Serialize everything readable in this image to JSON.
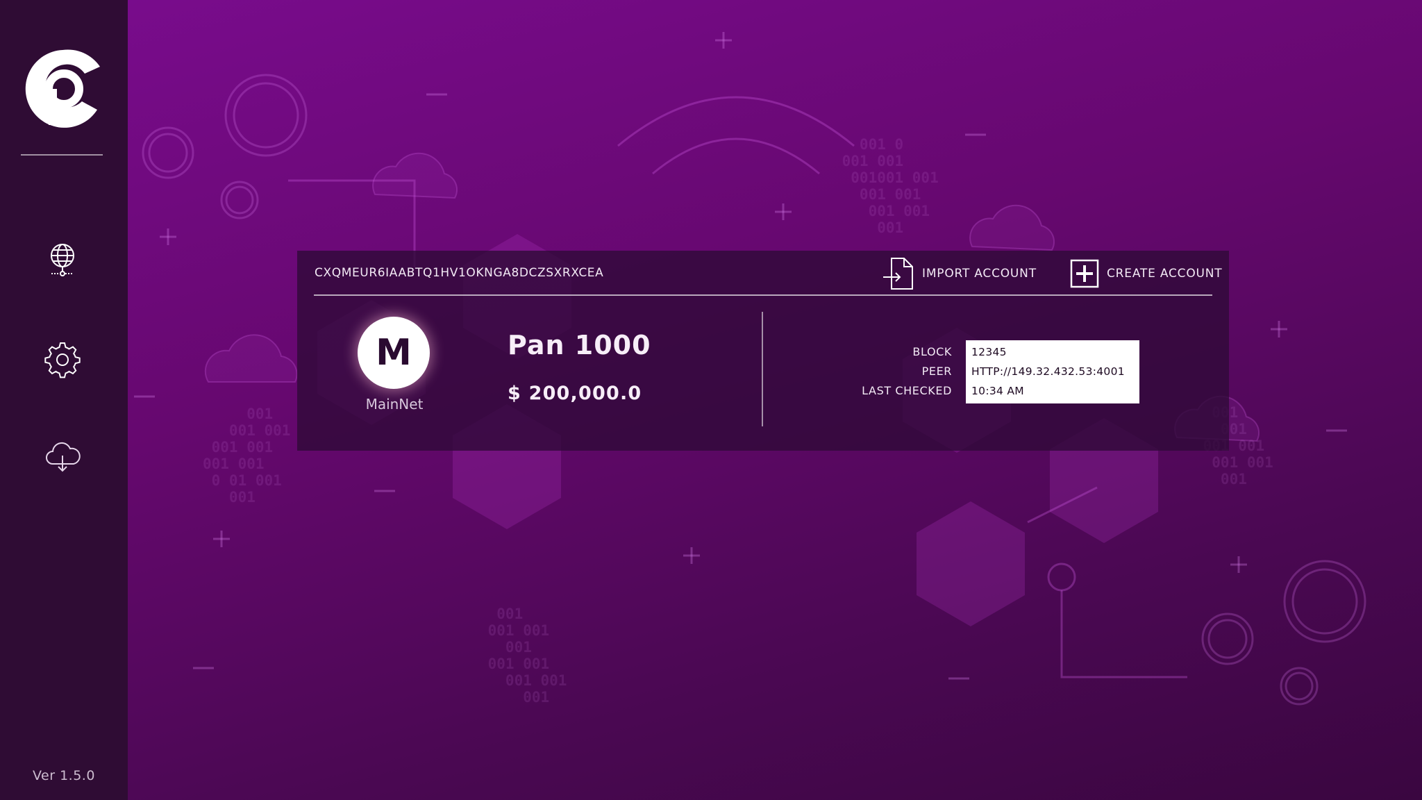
{
  "app": {
    "version": "Ver 1.5.0",
    "logo_icon": "p-logo-icon"
  },
  "sidebar": {
    "items": [
      {
        "name": "network",
        "icon": "globe-network-icon"
      },
      {
        "name": "settings",
        "icon": "gear-icon"
      },
      {
        "name": "download",
        "icon": "cloud-download-icon"
      }
    ]
  },
  "account": {
    "address": "CXQMEUR6IAABTQ1HV1OKNGA8DCZSXRXCEA",
    "import_label": "IMPORT ACCOUNT",
    "create_label": "CREATE ACCOUNT",
    "network_initial": "M",
    "network_name": "MainNet",
    "balance_name": "Pan 1000",
    "balance_value": "$ 200,000.0"
  },
  "node_info": {
    "block_label": "BLOCK",
    "peer_label": "PEER",
    "last_checked_label": "LAST CHECKED",
    "block_value": "12345",
    "peer_value": "HTTP://149.32.432.53:4001",
    "last_checked_value": "10:34 AM"
  },
  "colors": {
    "sidebar_bg": "#2f0c34",
    "background_top": "#7a0c8e",
    "background_bottom": "#3a0640",
    "panel_bg": "#300a38"
  }
}
